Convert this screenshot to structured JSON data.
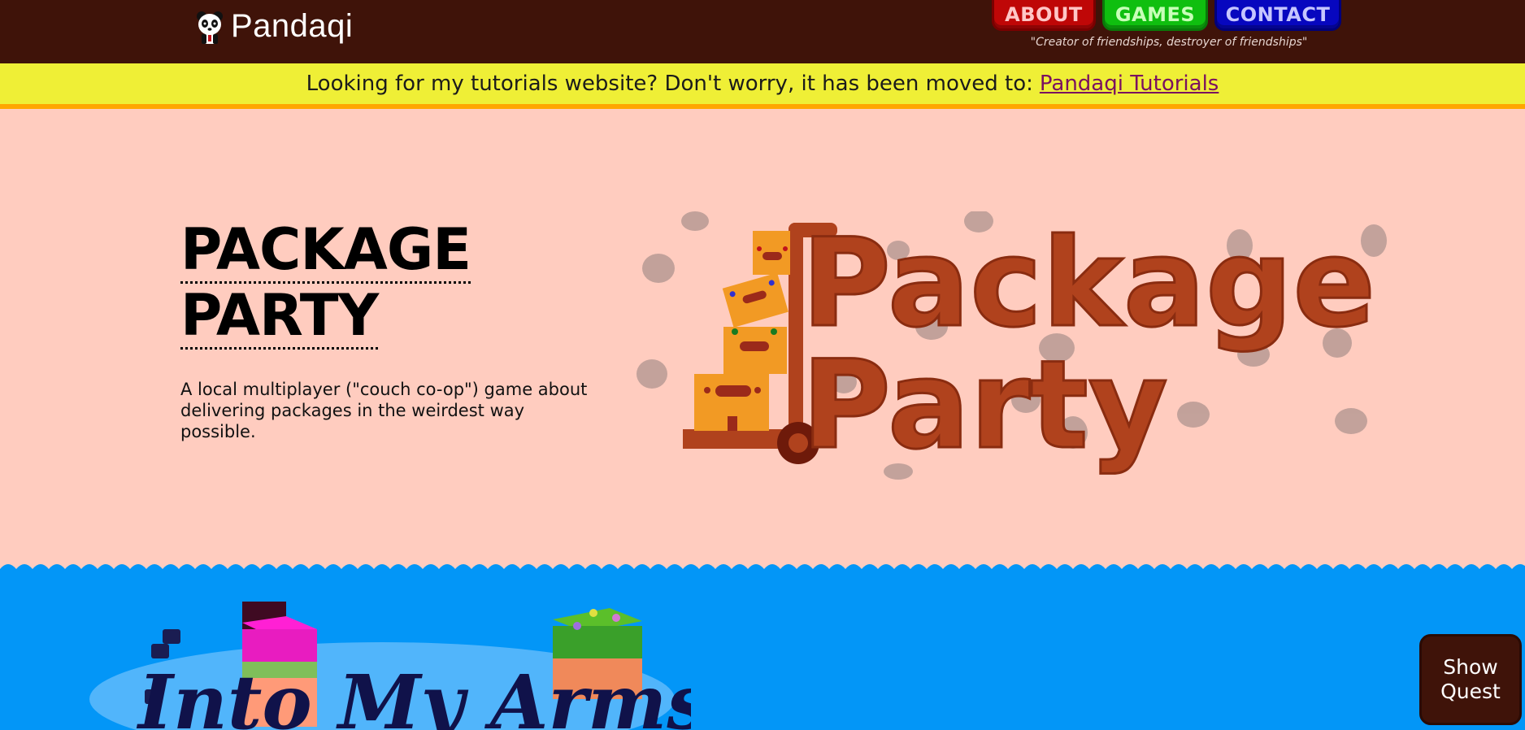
{
  "header": {
    "brand": "Pandaqi",
    "nav": [
      "ABOUT",
      "GAMES",
      "CONTACT"
    ],
    "tagline": "\"Creator of friendships, destroyer of friendships\"",
    "colors": {
      "bar": "#3f1309",
      "about": "#bf0707",
      "games": "#0fbf0f",
      "contact": "#0707bf"
    }
  },
  "notice": {
    "text": "Looking for my tutorials website? Don't worry, it has been moved to:",
    "link_text": "Pandaqi Tutorials"
  },
  "featured_game": {
    "title_line1": "PACKAGE",
    "title_line2": "PARTY",
    "description": "A local multiplayer (\"couch co-op\") game about delivering packages in the weirdest way possible.",
    "logo_line1": "Package",
    "logo_line2": "Party"
  },
  "next_game": {
    "logo_text": "Into My Arms"
  },
  "quest_button": {
    "line1": "Show",
    "line2": "Quest"
  },
  "icons": [
    "panda-icon"
  ]
}
